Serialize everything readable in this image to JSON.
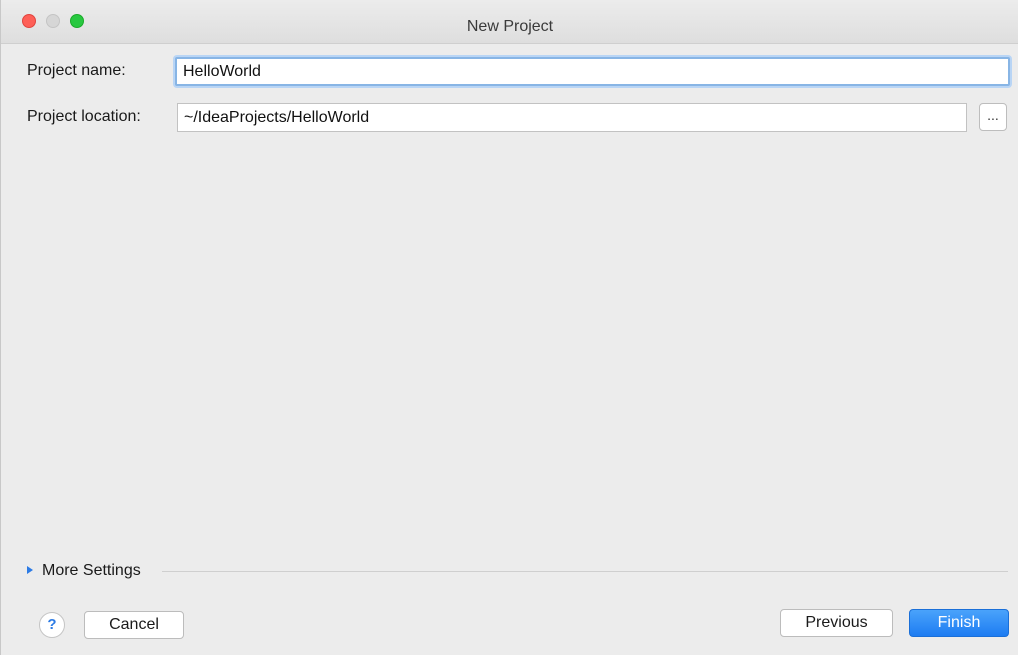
{
  "window": {
    "title": "New Project"
  },
  "form": {
    "name_label": "Project name:",
    "name_value": "HelloWorld",
    "location_label": "Project location:",
    "location_value": "~/IdeaProjects/HelloWorld",
    "browse_label": "..."
  },
  "more_settings": {
    "label": "More Settings"
  },
  "footer": {
    "help_label": "?",
    "cancel_label": "Cancel",
    "previous_label": "Previous",
    "finish_label": "Finish"
  },
  "colors": {
    "accent": "#1d7cf2",
    "focus_ring": "#88b5e5",
    "close": "#fe5f57",
    "zoom": "#28c840"
  }
}
